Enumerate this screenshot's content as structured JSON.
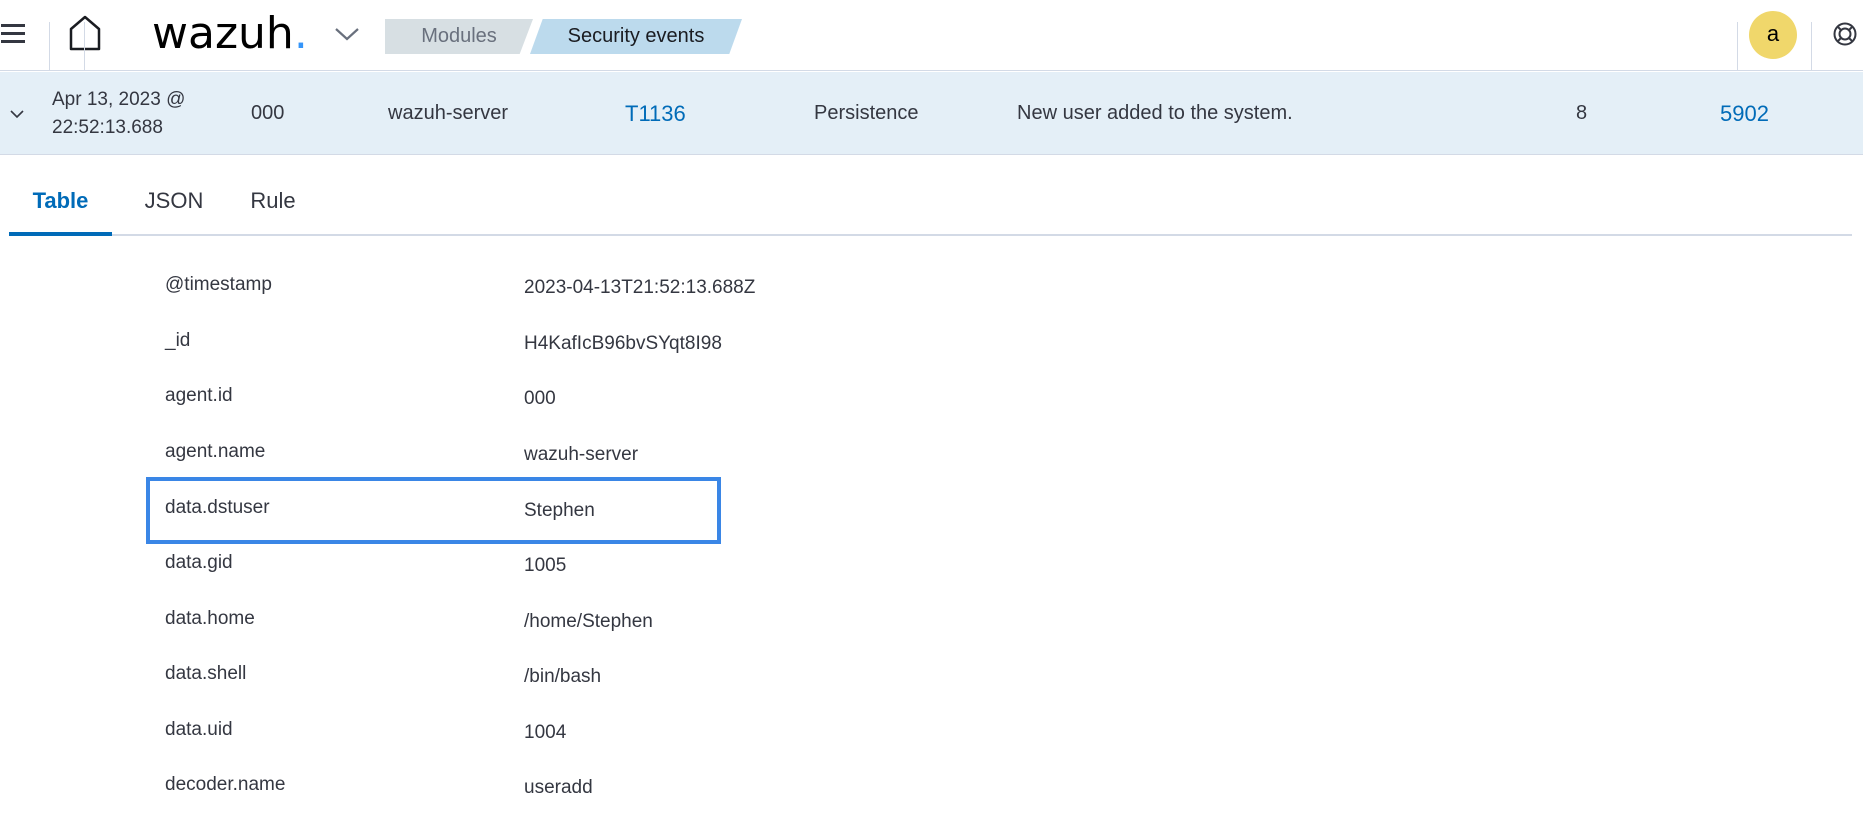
{
  "header": {
    "logo_text": "wazuh",
    "logo_dot": ".",
    "breadcrumbs": [
      "Modules",
      "Security events"
    ],
    "avatar_initial": "a",
    "icons": {
      "menu": "hamburger-menu-icon",
      "home": "home-icon",
      "logo_menu": "chevron-down-icon",
      "help": "lifebuoy-help-icon"
    }
  },
  "event": {
    "timestamp_line1": "Apr 13, 2023 @",
    "timestamp_line2": "22:52:13.688",
    "agent_id": "000",
    "agent_name": "wazuh-server",
    "technique": "T1136",
    "tactic": "Persistence",
    "description": "New user added to the system.",
    "level": "8",
    "rule_id": "5902"
  },
  "tabs": [
    {
      "label": "Table",
      "active": true
    },
    {
      "label": "JSON",
      "active": false
    },
    {
      "label": "Rule",
      "active": false
    }
  ],
  "fields": [
    {
      "key": "@timestamp",
      "value": "2023-04-13T21:52:13.688Z"
    },
    {
      "key": "_id",
      "value": "H4KafIcB96bvSYqt8I98"
    },
    {
      "key": "agent.id",
      "value": "000"
    },
    {
      "key": "agent.name",
      "value": "wazuh-server"
    },
    {
      "key": "data.dstuser",
      "value": "Stephen",
      "highlighted": true
    },
    {
      "key": "data.gid",
      "value": "1005"
    },
    {
      "key": "data.home",
      "value": "/home/Stephen"
    },
    {
      "key": "data.shell",
      "value": "/bin/bash"
    },
    {
      "key": "data.uid",
      "value": "1004"
    },
    {
      "key": "decoder.name",
      "value": "useradd"
    }
  ],
  "colors": {
    "accent": "#006bb8",
    "row_bg": "#e4eff7",
    "highlight_border": "#3a86e6",
    "avatar_bg": "#f0d76b",
    "logo_dot": "#3595f9"
  }
}
